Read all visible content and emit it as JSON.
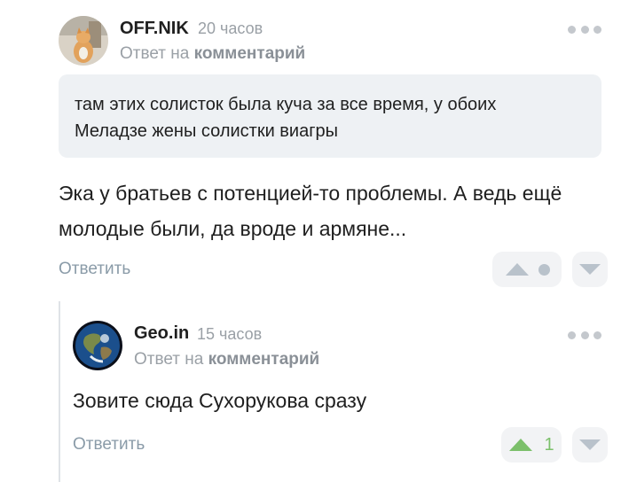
{
  "comment1": {
    "author": "OFF.NIK",
    "time": "20 часов",
    "reply_prefix": "Ответ на",
    "reply_link": "комментарий",
    "quote_line1": "там этих солисток была куча за все время, у обоих",
    "quote_line2": "Меладзе жены солистки виагры",
    "text_line1": "Эка у братьев с потенцией-то проблемы. А ведь ещё",
    "text_line2": "молодые были, да вроде и армяне...",
    "reply_label": "Ответить"
  },
  "comment2": {
    "author": "Geo.in",
    "time": "15 часов",
    "reply_prefix": "Ответ на",
    "reply_link": "комментарий",
    "text": "Зовите сюда Сухорукова сразу",
    "reply_label": "Ответить",
    "rating": "1"
  },
  "colors": {
    "upvote_active": "#7cc06b",
    "vote_inactive": "#b9c2cb",
    "reply_link": "#8a9ba8"
  }
}
